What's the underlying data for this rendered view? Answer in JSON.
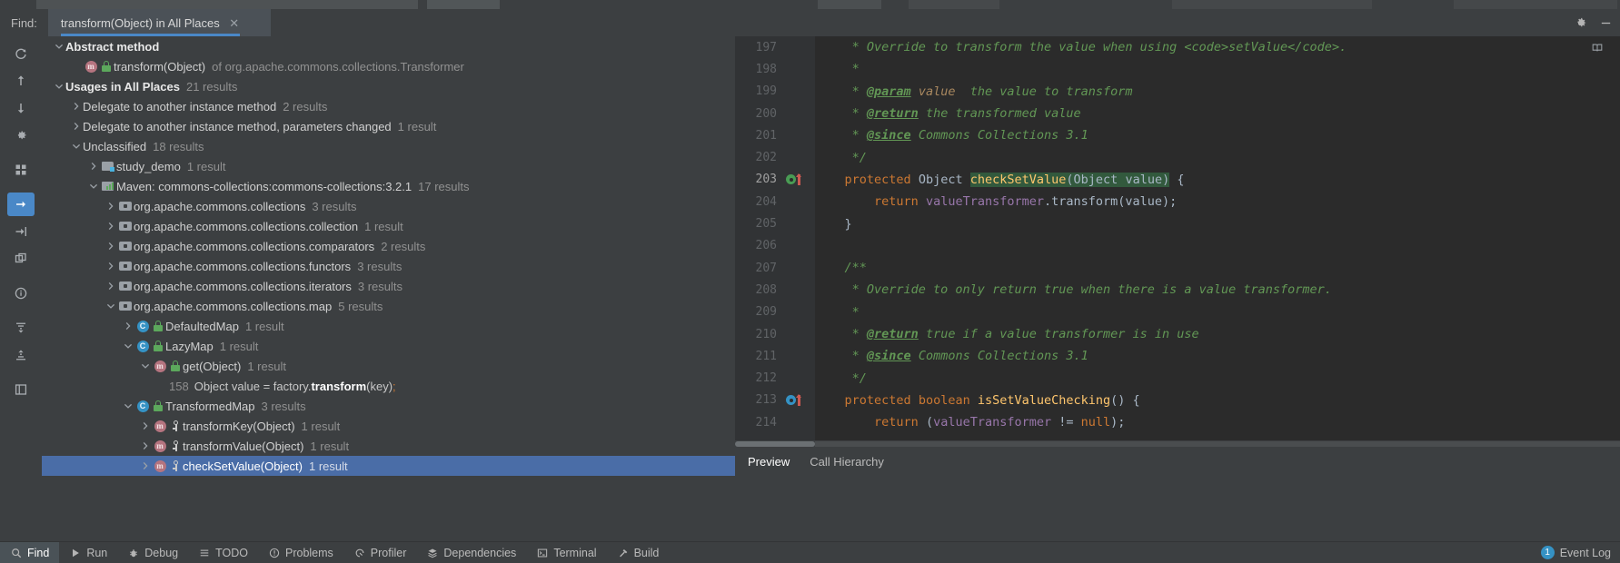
{
  "window": {
    "find_label": "Find:",
    "tab_title": "transform(Object) in All Places",
    "tab_close": "✕",
    "settings_icon": "gear-icon",
    "minimize_icon": "minimize-icon"
  },
  "left_rail": [
    {
      "name": "rerun",
      "glyph": "⟳"
    },
    {
      "name": "previous-occurrence",
      "glyph": "↑"
    },
    {
      "name": "next-occurrence",
      "glyph": "↓"
    },
    {
      "name": "settings",
      "glyph": "⚙"
    },
    {
      "name": "group-by-module",
      "glyph": "▦"
    },
    {
      "name": "open-in-find-window",
      "glyph": "→"
    },
    {
      "name": "export-to-text-file",
      "glyph": "⇥"
    },
    {
      "name": "merge-duplicates",
      "glyph": "⧉"
    },
    {
      "name": "show-usage-info",
      "glyph": "i"
    },
    {
      "name": "expand-all",
      "glyph": "⤓"
    },
    {
      "name": "collapse-all",
      "glyph": "⤒"
    },
    {
      "name": "preview-usages",
      "glyph": "▯"
    }
  ],
  "tree": [
    {
      "id": "abstract-method",
      "depth": 0,
      "arrow": "down",
      "icon": "none",
      "label": "Abstract method",
      "bold": true,
      "count": ""
    },
    {
      "id": "transform-object-transformer",
      "depth": 1,
      "arrow": "none",
      "icon": "method-lock",
      "label": "transform(Object)",
      "bold": false,
      "count": "of org.apache.commons.collections.Transformer",
      "countIsText": true
    },
    {
      "id": "usages-in-all-places",
      "depth": 0,
      "arrow": "down",
      "icon": "none",
      "label": "Usages in All Places",
      "bold": true,
      "count": "21 results"
    },
    {
      "id": "delegate-instance-method",
      "depth": 1,
      "arrow": "right",
      "icon": "none",
      "label": "Delegate to another instance method",
      "bold": false,
      "count": "2 results"
    },
    {
      "id": "delegate-params-changed",
      "depth": 1,
      "arrow": "right",
      "icon": "none",
      "label": "Delegate to another instance method, parameters changed",
      "bold": false,
      "count": "1 result"
    },
    {
      "id": "unclassified",
      "depth": 1,
      "arrow": "down",
      "icon": "none",
      "label": "Unclassified",
      "bold": false,
      "count": "18 results"
    },
    {
      "id": "study-demo",
      "depth": 2,
      "arrow": "right",
      "icon": "module",
      "label": "study_demo",
      "bold": false,
      "count": "1 result"
    },
    {
      "id": "maven-commons-collections",
      "depth": 2,
      "arrow": "down",
      "icon": "maven",
      "label": "Maven: commons-collections:commons-collections:3.2.1",
      "bold": false,
      "count": "17 results"
    },
    {
      "id": "pkg-collections",
      "depth": 3,
      "arrow": "right",
      "icon": "package",
      "label": "org.apache.commons.collections",
      "bold": false,
      "count": "3 results"
    },
    {
      "id": "pkg-collection",
      "depth": 3,
      "arrow": "right",
      "icon": "package",
      "label": "org.apache.commons.collections.collection",
      "bold": false,
      "count": "1 result"
    },
    {
      "id": "pkg-comparators",
      "depth": 3,
      "arrow": "right",
      "icon": "package",
      "label": "org.apache.commons.collections.comparators",
      "bold": false,
      "count": "2 results"
    },
    {
      "id": "pkg-functors",
      "depth": 3,
      "arrow": "right",
      "icon": "package",
      "label": "org.apache.commons.collections.functors",
      "bold": false,
      "count": "3 results"
    },
    {
      "id": "pkg-iterators",
      "depth": 3,
      "arrow": "right",
      "icon": "package",
      "label": "org.apache.commons.collections.iterators",
      "bold": false,
      "count": "3 results"
    },
    {
      "id": "pkg-map",
      "depth": 3,
      "arrow": "down",
      "icon": "package",
      "label": "org.apache.commons.collections.map",
      "bold": false,
      "count": "5 results"
    },
    {
      "id": "class-defaultedmap",
      "depth": 4,
      "arrow": "right",
      "icon": "class-lock",
      "label": "DefaultedMap",
      "bold": false,
      "count": "1 result"
    },
    {
      "id": "class-lazymap",
      "depth": 4,
      "arrow": "down",
      "icon": "class-lock",
      "label": "LazyMap",
      "bold": false,
      "count": "1 result"
    },
    {
      "id": "method-get-object",
      "depth": 5,
      "arrow": "down",
      "icon": "method-lock",
      "label": "get(Object)",
      "bold": false,
      "count": "1 result"
    },
    {
      "id": "usage-line-158",
      "depth": 6,
      "arrow": "none",
      "icon": "none",
      "isCode": true,
      "lineNumber": "158",
      "codePre": "Object value = factory.",
      "codeBold": "transform",
      "codePost": "(key)",
      "codeSemi": ";"
    },
    {
      "id": "class-transformedmap",
      "depth": 4,
      "arrow": "down",
      "icon": "class-lock",
      "label": "TransformedMap",
      "bold": false,
      "count": "3 results"
    },
    {
      "id": "method-transformkey",
      "depth": 5,
      "arrow": "right",
      "icon": "method-key",
      "label": "transformKey(Object)",
      "bold": false,
      "count": "1 result"
    },
    {
      "id": "method-transformvalue",
      "depth": 5,
      "arrow": "right",
      "icon": "method-key",
      "label": "transformValue(Object)",
      "bold": false,
      "count": "1 result"
    },
    {
      "id": "method-checksetvalue",
      "depth": 5,
      "arrow": "right",
      "icon": "method-key",
      "label": "checkSetValue(Object)",
      "bold": false,
      "count": "1 result",
      "selected": true
    }
  ],
  "editor": {
    "lines": [
      {
        "n": "197",
        "marker": "",
        "segs": [
          {
            "t": "     * Override to transform the value when using <code>setValue</code>.",
            "c": "cmt"
          }
        ]
      },
      {
        "n": "198",
        "marker": "",
        "segs": [
          {
            "t": "     *",
            "c": "cmt"
          }
        ]
      },
      {
        "n": "199",
        "marker": "",
        "segs": [
          {
            "t": "     * ",
            "c": "cmt"
          },
          {
            "t": "@param",
            "c": "jd"
          },
          {
            "t": " ",
            "c": "cmt"
          },
          {
            "t": "value",
            "c": "par"
          },
          {
            "t": "  the value to transform",
            "c": "cmt"
          }
        ]
      },
      {
        "n": "200",
        "marker": "",
        "segs": [
          {
            "t": "     * ",
            "c": "cmt"
          },
          {
            "t": "@return",
            "c": "jd"
          },
          {
            "t": " the transformed value",
            "c": "cmt"
          }
        ]
      },
      {
        "n": "201",
        "marker": "",
        "segs": [
          {
            "t": "     * ",
            "c": "cmt"
          },
          {
            "t": "@since",
            "c": "jd"
          },
          {
            "t": " Commons Collections 3.1",
            "c": "cmt"
          }
        ]
      },
      {
        "n": "202",
        "marker": "",
        "segs": [
          {
            "t": "     */",
            "c": "cmt"
          }
        ]
      },
      {
        "n": "203",
        "marker": "override",
        "current": true,
        "segs": [
          {
            "t": "    ",
            "c": "pln"
          },
          {
            "t": "protected",
            "c": "kw"
          },
          {
            "t": " ",
            "c": "pln"
          },
          {
            "t": "Object",
            "c": "typ"
          },
          {
            "t": " ",
            "c": "pln"
          },
          {
            "t": "checkSetValue",
            "c": "mth hl"
          },
          {
            "t": "(",
            "c": "pln hl"
          },
          {
            "t": "Object value",
            "c": "typ hl"
          },
          {
            "t": ")",
            "c": "pln hl"
          },
          {
            "t": " {",
            "c": "pln"
          }
        ]
      },
      {
        "n": "204",
        "marker": "",
        "segs": [
          {
            "t": "        ",
            "c": "pln"
          },
          {
            "t": "return",
            "c": "kw"
          },
          {
            "t": " ",
            "c": "pln"
          },
          {
            "t": "valueTransformer",
            "c": "fld"
          },
          {
            "t": ".transform(value);",
            "c": "pln"
          }
        ]
      },
      {
        "n": "205",
        "marker": "",
        "segs": [
          {
            "t": "    }",
            "c": "pln"
          }
        ]
      },
      {
        "n": "206",
        "marker": "",
        "segs": [
          {
            "t": "",
            "c": "pln"
          }
        ]
      },
      {
        "n": "207",
        "marker": "",
        "segs": [
          {
            "t": "    /**",
            "c": "cmt"
          }
        ]
      },
      {
        "n": "208",
        "marker": "",
        "segs": [
          {
            "t": "     * Override to only return true when there is a value transformer.",
            "c": "cmt"
          }
        ]
      },
      {
        "n": "209",
        "marker": "",
        "segs": [
          {
            "t": "     *",
            "c": "cmt"
          }
        ]
      },
      {
        "n": "210",
        "marker": "",
        "segs": [
          {
            "t": "     * ",
            "c": "cmt"
          },
          {
            "t": "@return",
            "c": "jd"
          },
          {
            "t": " true if a value transformer is in use",
            "c": "cmt"
          }
        ]
      },
      {
        "n": "211",
        "marker": "",
        "segs": [
          {
            "t": "     * ",
            "c": "cmt"
          },
          {
            "t": "@since",
            "c": "jd"
          },
          {
            "t": " Commons Collections 3.1",
            "c": "cmt"
          }
        ]
      },
      {
        "n": "212",
        "marker": "",
        "segs": [
          {
            "t": "     */",
            "c": "cmt"
          }
        ]
      },
      {
        "n": "213",
        "marker": "implement",
        "segs": [
          {
            "t": "    ",
            "c": "pln"
          },
          {
            "t": "protected",
            "c": "kw"
          },
          {
            "t": " ",
            "c": "pln"
          },
          {
            "t": "boolean",
            "c": "kw"
          },
          {
            "t": " ",
            "c": "pln"
          },
          {
            "t": "isSetValueChecking",
            "c": "mth"
          },
          {
            "t": "() {",
            "c": "pln"
          }
        ]
      },
      {
        "n": "214",
        "marker": "",
        "segs": [
          {
            "t": "        ",
            "c": "pln"
          },
          {
            "t": "return",
            "c": "kw"
          },
          {
            "t": " (",
            "c": "pln"
          },
          {
            "t": "valueTransformer",
            "c": "fld"
          },
          {
            "t": " != ",
            "c": "pln"
          },
          {
            "t": "null",
            "c": "kw"
          },
          {
            "t": ");",
            "c": "pln"
          }
        ]
      }
    ]
  },
  "preview_tabs": [
    {
      "id": "preview",
      "label": "Preview",
      "active": true
    },
    {
      "id": "call-hierarchy",
      "label": "Call Hierarchy",
      "active": false
    }
  ],
  "statusbar": {
    "items": [
      {
        "id": "find",
        "label": "Find",
        "glyph": "search-icon",
        "active": true
      },
      {
        "id": "run",
        "label": "Run",
        "glyph": "play-icon",
        "active": false
      },
      {
        "id": "debug",
        "label": "Debug",
        "glyph": "bug-icon",
        "active": false
      },
      {
        "id": "todo",
        "label": "TODO",
        "glyph": "list-icon",
        "active": false
      },
      {
        "id": "problems",
        "label": "Problems",
        "glyph": "warning-icon",
        "active": false
      },
      {
        "id": "profiler",
        "label": "Profiler",
        "glyph": "gauge-icon",
        "active": false
      },
      {
        "id": "dependencies",
        "label": "Dependencies",
        "glyph": "layers-icon",
        "active": false
      },
      {
        "id": "terminal",
        "label": "Terminal",
        "glyph": "terminal-icon",
        "active": false
      },
      {
        "id": "build",
        "label": "Build",
        "glyph": "hammer-icon",
        "active": false
      }
    ],
    "event_log": {
      "count": "1",
      "label": "Event Log"
    }
  },
  "colors": {
    "accent": "#4a88c7",
    "selection": "#4a6da7",
    "panel_bg": "#3c3f41",
    "editor_bg": "#2b2b2b",
    "comment_green": "#629755",
    "keyword_orange": "#cc7832",
    "method_yellow": "#ffc66d",
    "field_purple": "#9876aa"
  }
}
